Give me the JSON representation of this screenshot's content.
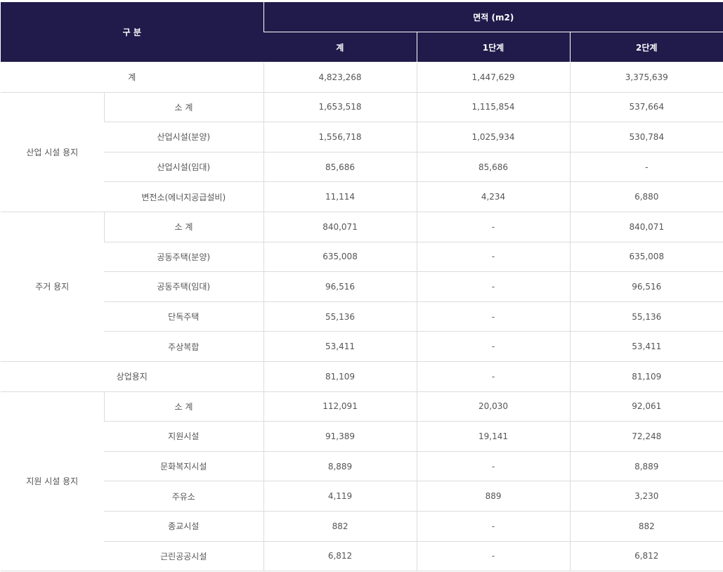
{
  "header": {
    "category": "구 분",
    "area": "면적 (m2)",
    "total": "계",
    "phase1": "1단계",
    "phase2": "2단계"
  },
  "grand_total": {
    "label": "계",
    "total": "4,823,268",
    "phase1": "1,447,629",
    "phase2": "3,375,639"
  },
  "industrial": {
    "label": "산업 시설 용지",
    "rows": [
      {
        "label": "소 계",
        "total": "1,653,518",
        "phase1": "1,115,854",
        "phase2": "537,664"
      },
      {
        "label": "산업시설(분양)",
        "total": "1,556,718",
        "phase1": "1,025,934",
        "phase2": "530,784"
      },
      {
        "label": "산업시설(임대)",
        "total": "85,686",
        "phase1": "85,686",
        "phase2": "-"
      },
      {
        "label": "변전소(에너지공급설비)",
        "total": "11,114",
        "phase1": "4,234",
        "phase2": "6,880"
      }
    ]
  },
  "residential": {
    "label": "주거 용지",
    "rows": [
      {
        "label": "소 계",
        "total": "840,071",
        "phase1": "-",
        "phase2": "840,071"
      },
      {
        "label": "공동주택(분양)",
        "total": "635,008",
        "phase1": "-",
        "phase2": "635,008"
      },
      {
        "label": "공동주택(임대)",
        "total": "96,516",
        "phase1": "-",
        "phase2": "96,516"
      },
      {
        "label": "단독주택",
        "total": "55,136",
        "phase1": "-",
        "phase2": "55,136"
      },
      {
        "label": "주상복합",
        "total": "53,411",
        "phase1": "-",
        "phase2": "53,411"
      }
    ]
  },
  "commercial": {
    "label": "상업용지",
    "total": "81,109",
    "phase1": "-",
    "phase2": "81,109"
  },
  "support": {
    "label": "지원 시설 용지",
    "rows": [
      {
        "label": "소 계",
        "total": "112,091",
        "phase1": "20,030",
        "phase2": "92,061"
      },
      {
        "label": "지원시설",
        "total": "91,389",
        "phase1": "19,141",
        "phase2": "72,248"
      },
      {
        "label": "문화복지시설",
        "total": "8,889",
        "phase1": "-",
        "phase2": "8,889"
      },
      {
        "label": "주유소",
        "total": "4,119",
        "phase1": "889",
        "phase2": "3,230"
      },
      {
        "label": "종교시설",
        "total": "882",
        "phase1": "-",
        "phase2": "882"
      },
      {
        "label": "근린공공시설",
        "total": "6,812",
        "phase1": "-",
        "phase2": "6,812"
      }
    ]
  }
}
